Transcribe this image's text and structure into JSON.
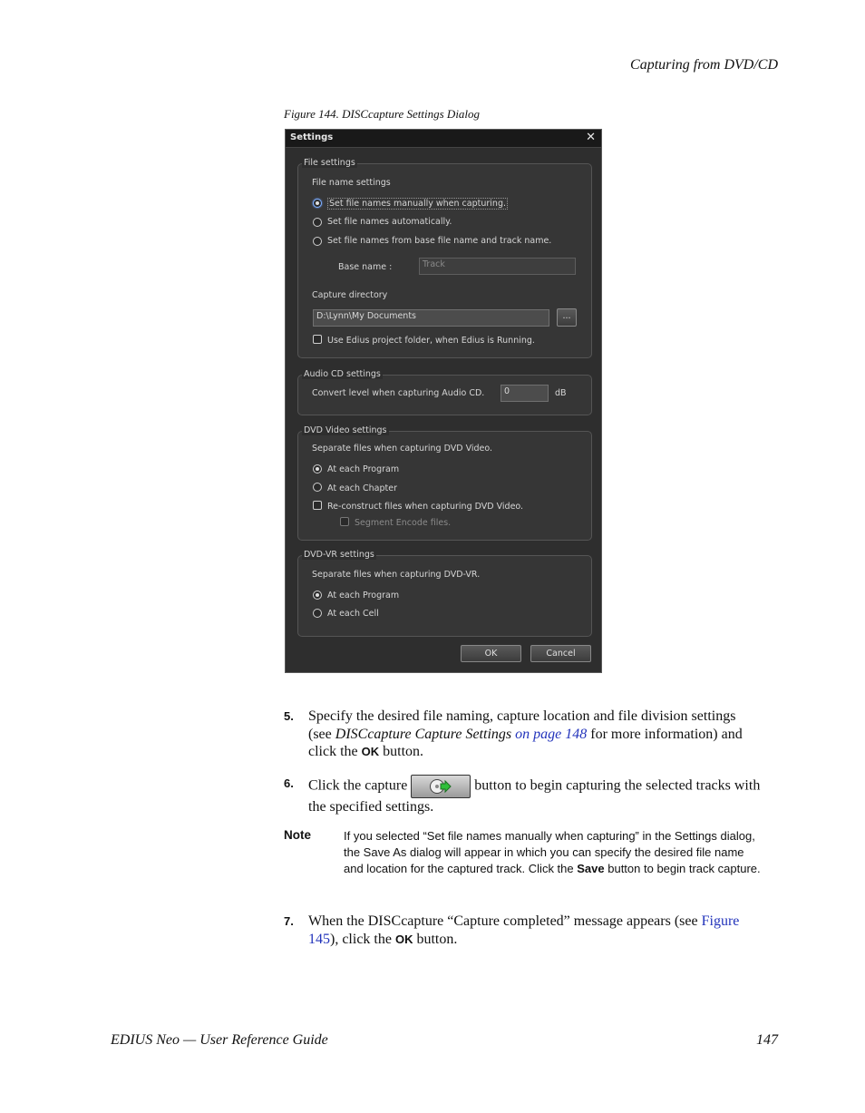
{
  "header": {
    "section": "Capturing from DVD/CD"
  },
  "figure": {
    "caption": "Figure 144.  DISCcapture Settings Dialog"
  },
  "dialog": {
    "title": "Settings",
    "close_glyph": "✕",
    "file_settings": {
      "label": "File settings",
      "file_name_settings": "File name settings",
      "opt_manual": "Set file names manually when capturing.",
      "opt_auto": "Set file names automatically.",
      "opt_base": "Set file names from base file name and track name.",
      "base_name_label": "Base name :",
      "base_name_value": "Track",
      "capture_directory": "Capture directory",
      "directory_value": "D:\\Lynn\\My Documents",
      "browse_label": "...",
      "use_project_folder": "Use Edius project folder, when Edius is Running."
    },
    "audio_cd": {
      "label": "Audio CD settings",
      "convert_label": "Convert level when capturing Audio CD.",
      "level_value": "0",
      "unit": "dB"
    },
    "dvd_video": {
      "label": "DVD Video settings",
      "separate_label": "Separate files when capturing DVD Video.",
      "opt_program": "At each Program",
      "opt_chapter": "At each Chapter",
      "reconstruct": "Re-construct files when capturing DVD Video.",
      "segment": "Segment Encode files."
    },
    "dvd_vr": {
      "label": "DVD-VR settings",
      "separate_label": "Separate files when capturing DVD-VR.",
      "opt_program": "At each Program",
      "opt_cell": "At each Cell"
    },
    "ok_label": "OK",
    "cancel_label": "Cancel"
  },
  "steps": {
    "s5": {
      "num": "5.",
      "a": "Specify the desired file naming, capture location and file division settings (see ",
      "ref_title": "DISCcapture Capture Settings",
      "ref_page": " on page 148",
      "b": " for more information) and click the ",
      "ok": "OK",
      "c": " button."
    },
    "s6": {
      "num": "6.",
      "a": "Click the capture",
      "b": "button to begin capturing the selected tracks with the specified settings."
    },
    "s7": {
      "num": "7.",
      "a": "When the DISCcapture “Capture completed” message appears (see ",
      "ref": "Figure 145",
      "b": "), click the ",
      "ok": "OK",
      "c": " button."
    }
  },
  "note": {
    "label": "Note",
    "a": "If you selected “Set file names manually when capturing” in the Settings dialog, the Save As dialog will appear in which you can specify the desired file name and location for the captured track. Click the ",
    "save": "Save",
    "b": " button to begin track capture."
  },
  "footer": {
    "title": "EDIUS Neo  —  User Reference Guide",
    "page": "147"
  }
}
